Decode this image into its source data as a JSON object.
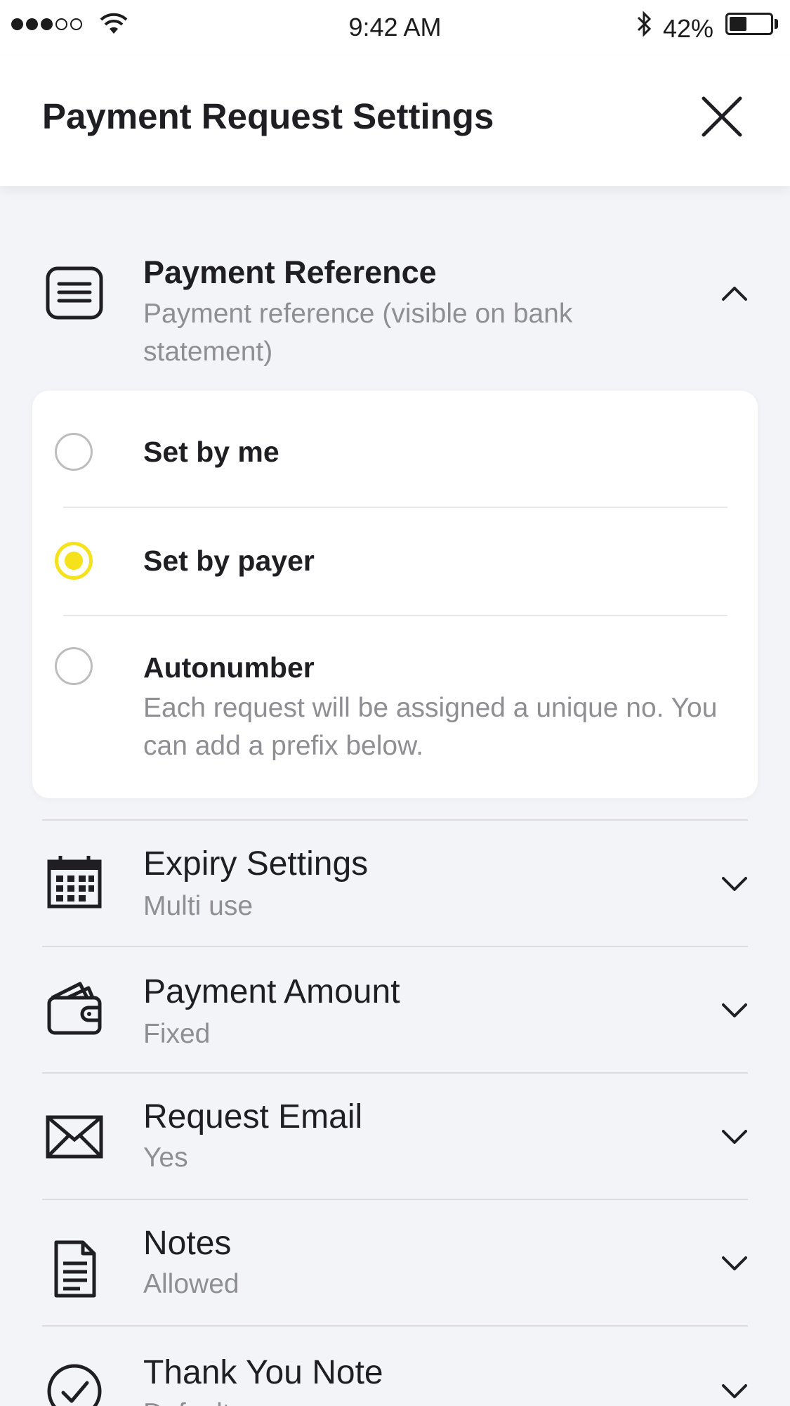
{
  "status_bar": {
    "time": "9:42 AM",
    "battery_percent_text": "42%",
    "battery_level": 0.42,
    "signal_bars_filled": 3,
    "signal_bars_total": 5
  },
  "header": {
    "title": "Payment Request Settings",
    "close_icon": "close-icon"
  },
  "payment_reference": {
    "title": "Payment Reference",
    "subtitle": "Payment reference (visible on bank statement)",
    "icon": "list-document-icon",
    "expanded": true,
    "options": [
      {
        "label": "Set by me",
        "selected": false
      },
      {
        "label": "Set by payer",
        "selected": true
      },
      {
        "label": "Autonumber",
        "description": "Each request will be assigned a unique no. You can add a prefix below.",
        "selected": false
      }
    ]
  },
  "settings": [
    {
      "title": "Expiry Settings",
      "value": "Multi use",
      "icon": "calendar-icon"
    },
    {
      "title": "Payment Amount",
      "value": "Fixed",
      "icon": "wallet-icon"
    },
    {
      "title": "Request Email",
      "value": "Yes",
      "icon": "envelope-icon"
    },
    {
      "title": "Notes",
      "value": "Allowed",
      "icon": "note-icon"
    },
    {
      "title": "Thank You Note",
      "value": "Default",
      "icon": "check-circle-icon"
    }
  ],
  "colors": {
    "accent": "#f5e11c",
    "background": "#f3f4f8",
    "text": "#1f1f23",
    "muted": "#8e8e93"
  }
}
